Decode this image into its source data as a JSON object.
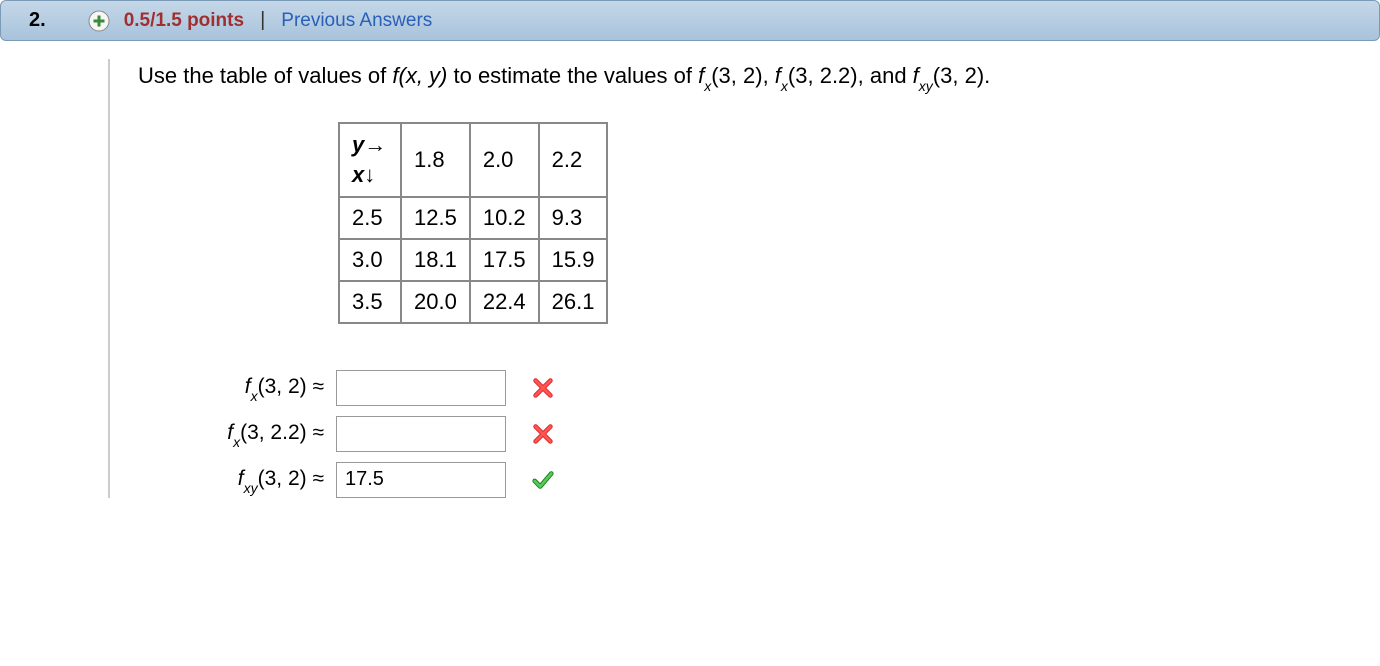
{
  "header": {
    "question_number": "2.",
    "points": "0.5/1.5 points",
    "separator": "|",
    "prev_answers": "Previous Answers"
  },
  "prompt": {
    "lead": "Use the table of values of ",
    "fx_y": "f(x, y)",
    "mid1": " to estimate the values of ",
    "fx32": "(3, 2)",
    "mid2": ", ",
    "fx322": "(3, 2.2)",
    "mid3": ", and ",
    "fxy32": "(3, 2)",
    "end": "."
  },
  "table": {
    "y_label": "y",
    "x_label": "x",
    "headers": [
      "1.8",
      "2.0",
      "2.2"
    ],
    "rows": [
      {
        "x": "2.5",
        "cells": [
          "12.5",
          "10.2",
          "9.3"
        ]
      },
      {
        "x": "3.0",
        "cells": [
          "18.1",
          "17.5",
          "15.9"
        ]
      },
      {
        "x": "3.5",
        "cells": [
          "20.0",
          "22.4",
          "26.1"
        ]
      }
    ]
  },
  "answers": {
    "approx": "≈",
    "items": [
      {
        "label_pre": "f",
        "label_sub": "x",
        "label_arg": "(3, 2)",
        "value": "",
        "status": "wrong"
      },
      {
        "label_pre": "f",
        "label_sub": "x",
        "label_arg": "(3, 2.2)",
        "value": "",
        "status": "wrong"
      },
      {
        "label_pre": "f",
        "label_sub": "xy",
        "label_arg": "(3, 2)",
        "value": "17.5",
        "status": "correct"
      }
    ]
  }
}
